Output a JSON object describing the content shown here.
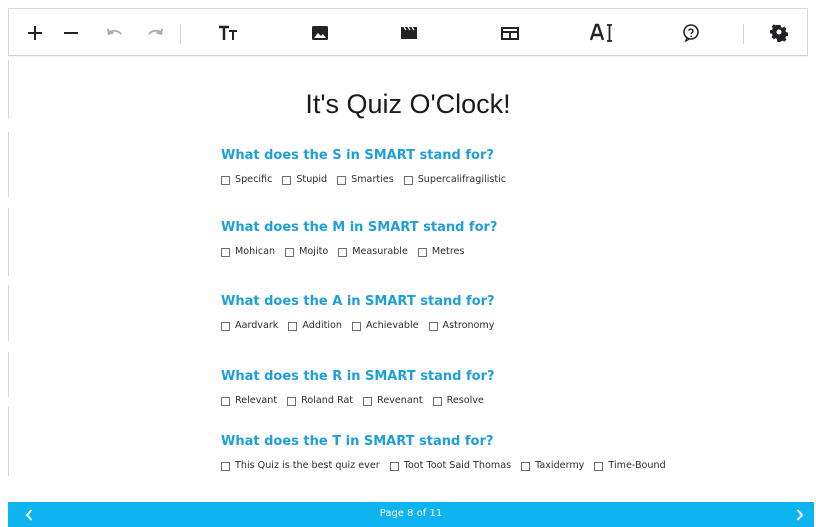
{
  "toolbar": {
    "tools": [
      {
        "name": "zoom-in-icon",
        "label": "+"
      },
      {
        "name": "zoom-out-icon",
        "label": "−"
      },
      {
        "name": "undo-icon",
        "label": ""
      },
      {
        "name": "redo-icon",
        "label": ""
      },
      {
        "name": "text-size-icon",
        "label": "Tт"
      },
      {
        "name": "image-icon",
        "label": ""
      },
      {
        "name": "video-icon",
        "label": ""
      },
      {
        "name": "layout-icon",
        "label": ""
      },
      {
        "name": "text-cursor-icon",
        "label": "A"
      },
      {
        "name": "help-icon",
        "label": "?"
      },
      {
        "name": "settings-icon",
        "label": ""
      }
    ]
  },
  "quiz": {
    "title": "It's Quiz O'Clock!",
    "questions": [
      {
        "text": "What does the S in SMART stand for?",
        "options": [
          "Specific",
          "Stupid",
          "Smarties",
          "Supercalifragilistic"
        ]
      },
      {
        "text": "What does the M in SMART stand for?",
        "options": [
          "Mohican",
          "Mojito",
          "Measurable",
          "Metres"
        ]
      },
      {
        "text": "What does the A in SMART stand for?",
        "options": [
          "Aardvark",
          "Addition",
          "Achievable",
          "Astronomy"
        ]
      },
      {
        "text": "What does the R in SMART stand for?",
        "options": [
          "Relevant",
          "Roland Rat",
          "Revenant",
          "Resolve"
        ]
      },
      {
        "text": "What does the T in SMART stand for?",
        "options": [
          "This Quiz is the best quiz ever",
          "Toot Toot Said Thomas",
          "Taxidermy",
          "Time-Bound"
        ]
      }
    ]
  },
  "footer": {
    "page_label": "Page 8 of 11",
    "prev_icon": "chevron-left-icon",
    "next_icon": "chevron-right-icon"
  },
  "colors": {
    "accent": "#1f9fd8",
    "footer": "#0db4ef",
    "text": "#2d2d2d",
    "disabled_icon": "#a8acb2"
  }
}
